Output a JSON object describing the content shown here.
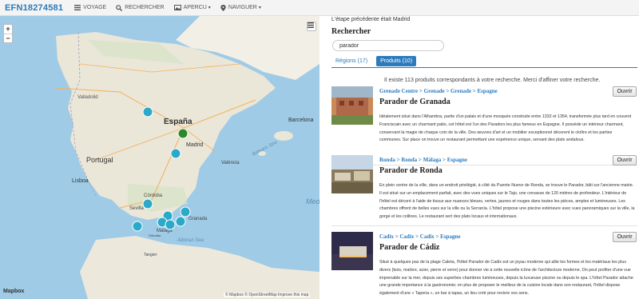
{
  "header": {
    "brand": "EFN18274581",
    "nav": [
      {
        "label": "VOYAGE",
        "icon": "list-icon"
      },
      {
        "label": "RECHERCHER",
        "icon": "search-icon"
      },
      {
        "label": "APERCU",
        "icon": "image-icon",
        "caret": "▾"
      },
      {
        "label": "NAVIGUER",
        "icon": "pin-icon",
        "caret": "▾"
      }
    ]
  },
  "map": {
    "zoom_in": "+",
    "zoom_out": "−",
    "logo": "Mapbox",
    "attribution": "© Mapbox © OpenStreetMap Improve this map",
    "labels": {
      "valladolid": "Valladolid",
      "espana": "España",
      "barcelona": "Barcelona",
      "madrid": "Madrid",
      "portugal": "Portugal",
      "valencia": "València",
      "lisboa": "Lisboa",
      "cordoba": "Córdoba",
      "sevilla": "Sevilla",
      "granada": "Granada",
      "malaga": "Málaga",
      "balearic": "Balearic Sea",
      "alboran": "Alboran Sea",
      "medit": "Medit",
      "gibraltar": "Gibraltar",
      "tangier": "Tangier"
    },
    "marker_color": "#2aa9c9",
    "current_marker_color": "#2a8a2a"
  },
  "panel": {
    "previous_step": "L'étape précédente était Madrid",
    "search_title": "Rechercher",
    "search_value": "parador",
    "tabs": [
      {
        "label": "Régions (17)",
        "active": false
      },
      {
        "label": "Produits (10)",
        "active": true
      }
    ],
    "count_text": "Il existe 113 produits correspondants à votre recherche. Merci d'affiner votre recherche.",
    "open_label": "Ouvrir",
    "results": [
      {
        "crumbs": "Grenade Centre > Grenade > Grenade > Espagne",
        "title": "Parador de Granada",
        "description": "Idéalement situé dans l'Alhambra, partie d'un palais et d'une mosquée construite entre 1332 et 1354, transformée plus tard en couvent Franciscain avec un charmant patio, cet hôtel est l'un des Paradors les plus fameux en Espagne. Il possède un intérieur charmant, conservant la magie de chaque coin de la ville. Des œuvres d'art et un mobilier exceptionnel décorent le cloître et les parties communes. Sur place on trouve un restaurant permettant une expérience unique, servant des plats andalous."
      },
      {
        "crumbs": "Ronda > Ronda > Málaga > Espagne",
        "title": "Parador de Ronda",
        "description": "En plein centre de la ville, dans un endroit privilégié, à côté du Puente Nuevo de Ronda, se trouve le Parador, bâti sur l'ancienne mairie. Il est situé sur un emplacement parfait, avec des vues uniques sur le Tajo, une crevasse de 120 mètres de profondeur. L'intérieur de l'hôtel est décoré à l'aide de tissus aux nuances bleues, vertes, jaunes et rouges dans toutes les pièces, amples et lumineuses. Les chambres offrent de belles vues sur la ville ou la Serranía. L'hôtel propose une piscine extérieure avec vues panoramiques sur la ville, la gorge et les collines. Le restaurant sert des plats locaux et internationaux."
      },
      {
        "crumbs": "Cadix > Cadix > Cadix > Espagne",
        "title": "Parador de Cádiz",
        "description": "Situé à quelques pas de la plage Caleta, l'hôtel Parador de Cadix est un joyau moderne qui allie les formes et les matériaux les plus divers (bois, marbre, acier, pierre et verre) pour donner vie à cette nouvelle icône de l'architecture moderne. On peut profiter d'une vue imprenable sur la mer, depuis ses superbes chambres lumineuses, depuis la luxueuse piscine ou depuis le spa. L'hôtel Parador attache une grande importance à la gastronomie; en plus de proposer le meilleur de la cuisine locale dans son restaurant, l'hôtel dispose également d'une « Taperia », un bar à tapas, un lieu créé pour revivre vos sens."
      }
    ]
  }
}
